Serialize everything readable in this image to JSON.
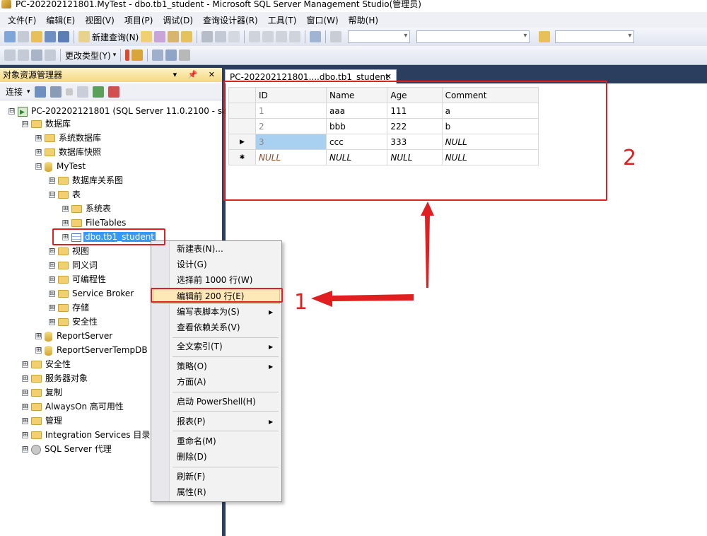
{
  "window": {
    "title": "PC-202202121801.MyTest - dbo.tb1_student - Microsoft SQL Server Management Studio(管理员)"
  },
  "menubar": [
    "文件(F)",
    "编辑(E)",
    "视图(V)",
    "项目(P)",
    "调试(D)",
    "查询设计器(R)",
    "工具(T)",
    "窗口(W)",
    "帮助(H)"
  ],
  "toolbar1": {
    "new_query": "新建查询(N)"
  },
  "toolbar2": {
    "change_type": "更改类型(Y)"
  },
  "object_explorer": {
    "title": "对象资源管理器",
    "controls": "▾ 📌 ✕",
    "connect": "连接",
    "tree": [
      {
        "label": "PC-202202121801 (SQL Server 11.0.2100 - sa)",
        "toggle": "⊟"
      },
      {
        "label": "数据库",
        "toggle": "⊟"
      },
      {
        "label": "系统数据库",
        "toggle": "⊞"
      },
      {
        "label": "数据库快照",
        "toggle": "⊞"
      },
      {
        "label": "MyTest",
        "toggle": "⊟"
      },
      {
        "label": "数据库关系图",
        "toggle": "⊞"
      },
      {
        "label": "表",
        "toggle": "⊟"
      },
      {
        "label": "系统表",
        "toggle": "⊞"
      },
      {
        "label": "FileTables",
        "toggle": "⊞"
      },
      {
        "label": "dbo.tb1_student",
        "toggle": "⊞"
      },
      {
        "label": "视图",
        "toggle": "⊞"
      },
      {
        "label": "同义词",
        "toggle": "⊞"
      },
      {
        "label": "可编程性",
        "toggle": "⊞"
      },
      {
        "label": "Service Broker",
        "toggle": "⊞"
      },
      {
        "label": "存储",
        "toggle": "⊞"
      },
      {
        "label": "安全性",
        "toggle": "⊞"
      },
      {
        "label": "ReportServer",
        "toggle": "⊞"
      },
      {
        "label": "ReportServerTempDB",
        "toggle": "⊞"
      },
      {
        "label": "安全性",
        "toggle": "⊞"
      },
      {
        "label": "服务器对象",
        "toggle": "⊞"
      },
      {
        "label": "复制",
        "toggle": "⊞"
      },
      {
        "label": "AlwaysOn 高可用性",
        "toggle": "⊞"
      },
      {
        "label": "管理",
        "toggle": "⊞"
      },
      {
        "label": "Integration Services 目录",
        "toggle": "⊞"
      },
      {
        "label": "SQL Server 代理",
        "toggle": "⊞"
      }
    ]
  },
  "context_menu": [
    "新建表(N)...",
    "设计(G)",
    "选择前 1000 行(W)",
    "编辑前 200 行(E)",
    "编写表脚本为(S)",
    "查看依赖关系(V)",
    "全文索引(T)",
    "策略(O)",
    "方面(A)",
    "启动 PowerShell(H)",
    "报表(P)",
    "重命名(M)",
    "删除(D)",
    "刷新(F)",
    "属性(R)"
  ],
  "doc_tab": {
    "label": "PC-202202121801....dbo.tb1_student",
    "close": "✕"
  },
  "grid": {
    "columns": [
      "ID",
      "Name",
      "Age",
      "Comment"
    ],
    "rows": [
      {
        "marker": "",
        "cells": [
          "1",
          "aaa",
          "111",
          "a"
        ]
      },
      {
        "marker": "",
        "cells": [
          "2",
          "bbb",
          "222",
          "b"
        ]
      },
      {
        "marker": "▶",
        "cells": [
          "3",
          "ccc",
          "333",
          "NULL"
        ]
      },
      {
        "marker": "✱",
        "cells": [
          "NULL",
          "NULL",
          "NULL",
          "NULL"
        ]
      }
    ]
  },
  "annotations": {
    "step1": "1",
    "step2": "2",
    "color": "#e02020"
  }
}
